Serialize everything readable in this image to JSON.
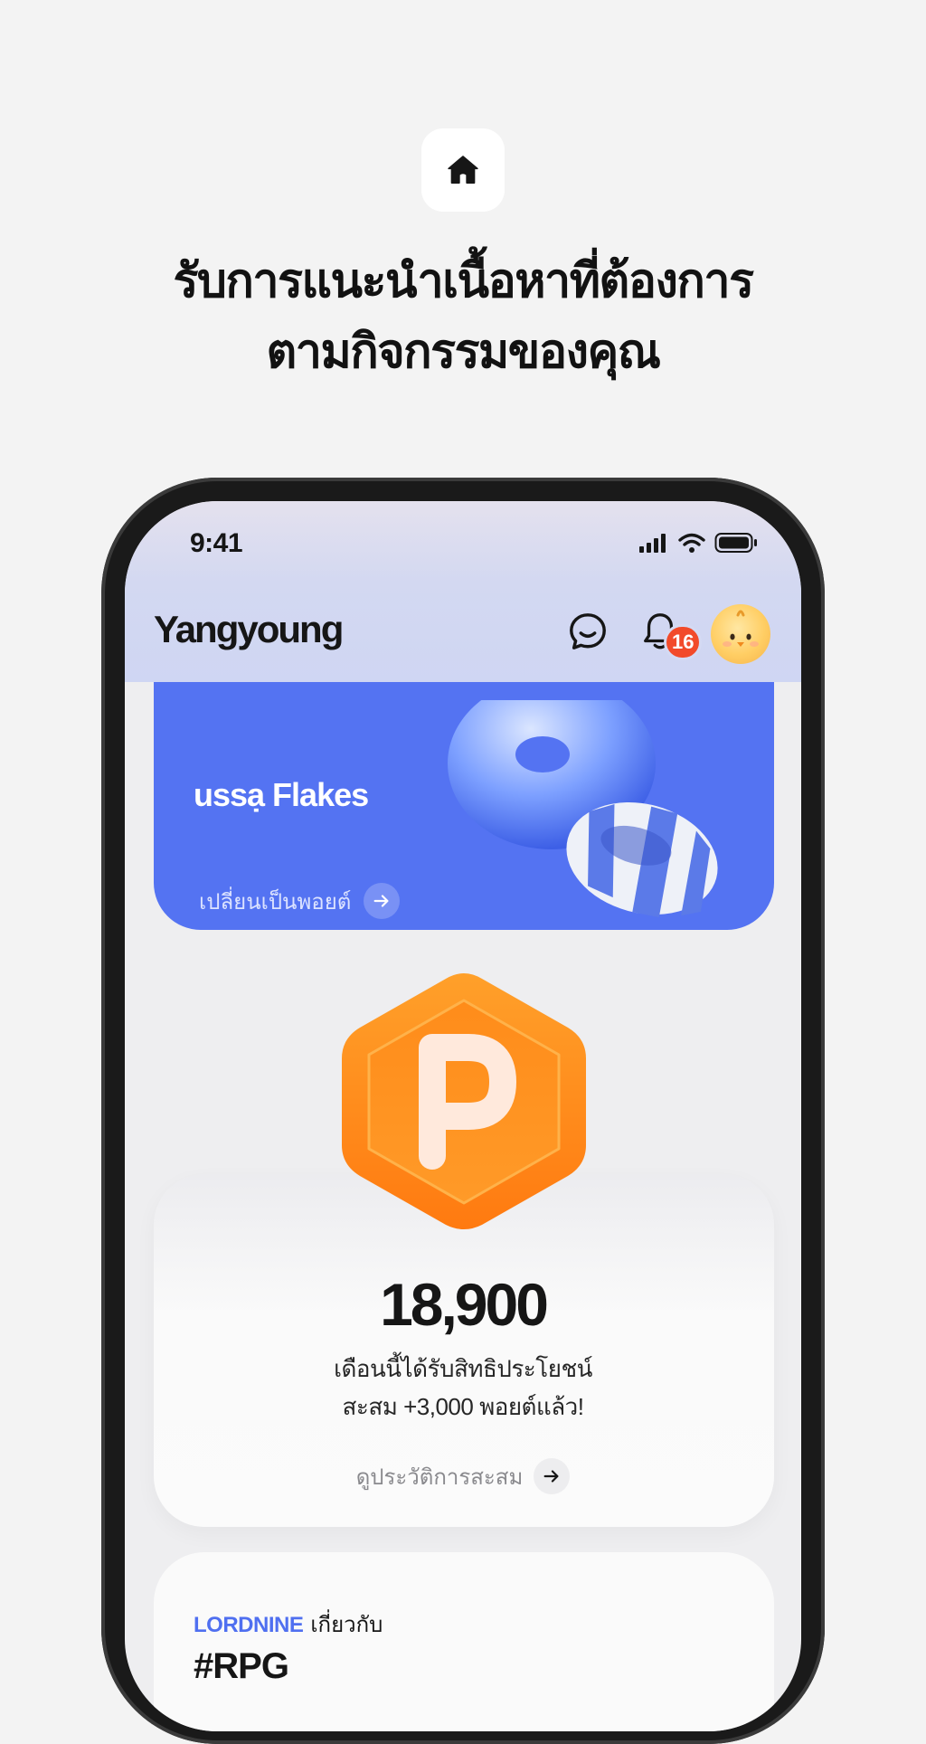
{
  "headline": {
    "icon": "home-icon",
    "line1": "รับการแนะนำเนื้อหาที่ต้องการ",
    "line2": "ตามกิจกรรมของคุณ"
  },
  "status_bar": {
    "time": "9:41",
    "icons": [
      "signal-icon",
      "wifi-icon",
      "battery-icon"
    ]
  },
  "header": {
    "app_name": "Yangyoung",
    "icons": [
      "chat-icon",
      "bell-icon"
    ],
    "notification_count": "16"
  },
  "promo_card": {
    "title": "ussạ Flakes",
    "link_label": "เปลี่ยนเป็นพอยต์",
    "color": "#5473f2"
  },
  "points": {
    "coin_letter": "P",
    "value": "18,900",
    "desc_line1": "เดือนนี้ได้รับสิทธิประโยชน์",
    "desc_line2": "สะสม +3,000 พอยต์แล้ว!",
    "history_label": "ดูประวัติการสะสม",
    "coin_color": "#ff8c1a"
  },
  "game_card": {
    "brand": "LORDNINE",
    "about": "เกี่ยวกับ",
    "tag": "#RPG",
    "brand_color": "#4f6ff0"
  }
}
